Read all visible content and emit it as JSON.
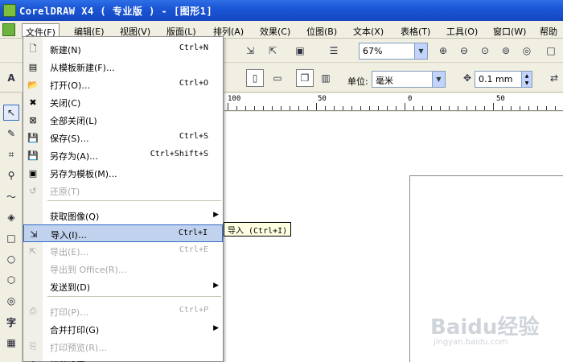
{
  "window": {
    "title": "CorelDRAW X4 ( 专业版 ) - [图形1]"
  },
  "menubar": {
    "items": [
      {
        "label": "文件(F)"
      },
      {
        "label": "编辑(E)"
      },
      {
        "label": "视图(V)"
      },
      {
        "label": "版面(L)"
      },
      {
        "label": "排列(A)"
      },
      {
        "label": "效果(C)"
      },
      {
        "label": "位图(B)"
      },
      {
        "label": "文本(X)"
      },
      {
        "label": "表格(T)"
      },
      {
        "label": "工具(O)"
      },
      {
        "label": "窗口(W)"
      },
      {
        "label": "帮助"
      }
    ]
  },
  "toolbar": {
    "zoom": "67%",
    "units_label": "单位:",
    "units_value": "毫米",
    "nudge_value": "0.1 mm",
    "font_prefix": "A"
  },
  "ruler": {
    "labels": [
      "100",
      "50",
      "0",
      "50"
    ]
  },
  "file_menu": {
    "items": [
      {
        "label": "新建(N)",
        "shortcut": "Ctrl+N",
        "icon": "new-doc-icon",
        "disabled": false
      },
      {
        "label": "从模板新建(F)…",
        "shortcut": "",
        "icon": "template-icon",
        "disabled": false
      },
      {
        "label": "打开(O)…",
        "shortcut": "Ctrl+O",
        "icon": "folder-open-icon",
        "disabled": false
      },
      {
        "label": "关闭(C)",
        "shortcut": "",
        "icon": "close-doc-icon",
        "disabled": false
      },
      {
        "label": "全部关闭(L)",
        "shortcut": "",
        "icon": "close-all-icon",
        "disabled": false
      },
      {
        "label": "保存(S)…",
        "shortcut": "Ctrl+S",
        "icon": "save-icon",
        "disabled": false
      },
      {
        "label": "另存为(A)…",
        "shortcut": "Ctrl+Shift+S",
        "icon": "save-as-icon",
        "disabled": false
      },
      {
        "label": "另存为模板(M)...",
        "shortcut": "",
        "icon": "save-template-icon",
        "disabled": false
      },
      {
        "label": "还原(T)",
        "shortcut": "",
        "icon": "revert-icon",
        "disabled": true
      },
      {
        "label": "获取图像(Q)",
        "shortcut": "",
        "icon": "",
        "disabled": false,
        "submenu": true
      },
      {
        "label": "导入(I)…",
        "shortcut": "Ctrl+I",
        "icon": "import-icon",
        "disabled": false,
        "hover": true
      },
      {
        "label": "导出(E)…",
        "shortcut": "Ctrl+E",
        "icon": "export-icon",
        "disabled": true
      },
      {
        "label": "导出到 Office(R)…",
        "shortcut": "",
        "icon": "",
        "disabled": true
      },
      {
        "label": "发送到(D)",
        "shortcut": "",
        "icon": "",
        "disabled": false,
        "submenu": true
      },
      {
        "label": "打印(P)…",
        "shortcut": "Ctrl+P",
        "icon": "print-icon",
        "disabled": true
      },
      {
        "label": "合并打印(G)",
        "shortcut": "",
        "icon": "",
        "disabled": false,
        "submenu": true
      },
      {
        "label": "打印预览(R)…",
        "shortcut": "",
        "icon": "print-preview-icon",
        "disabled": true
      },
      {
        "label": "打印设置(U)…",
        "shortcut": "",
        "icon": "print-setup-icon",
        "disabled": false
      }
    ]
  },
  "tooltip": {
    "text": "导入 (Ctrl+I)"
  },
  "watermark": {
    "logo": "Baidu经验",
    "url": "jingyan.baidu.com"
  }
}
